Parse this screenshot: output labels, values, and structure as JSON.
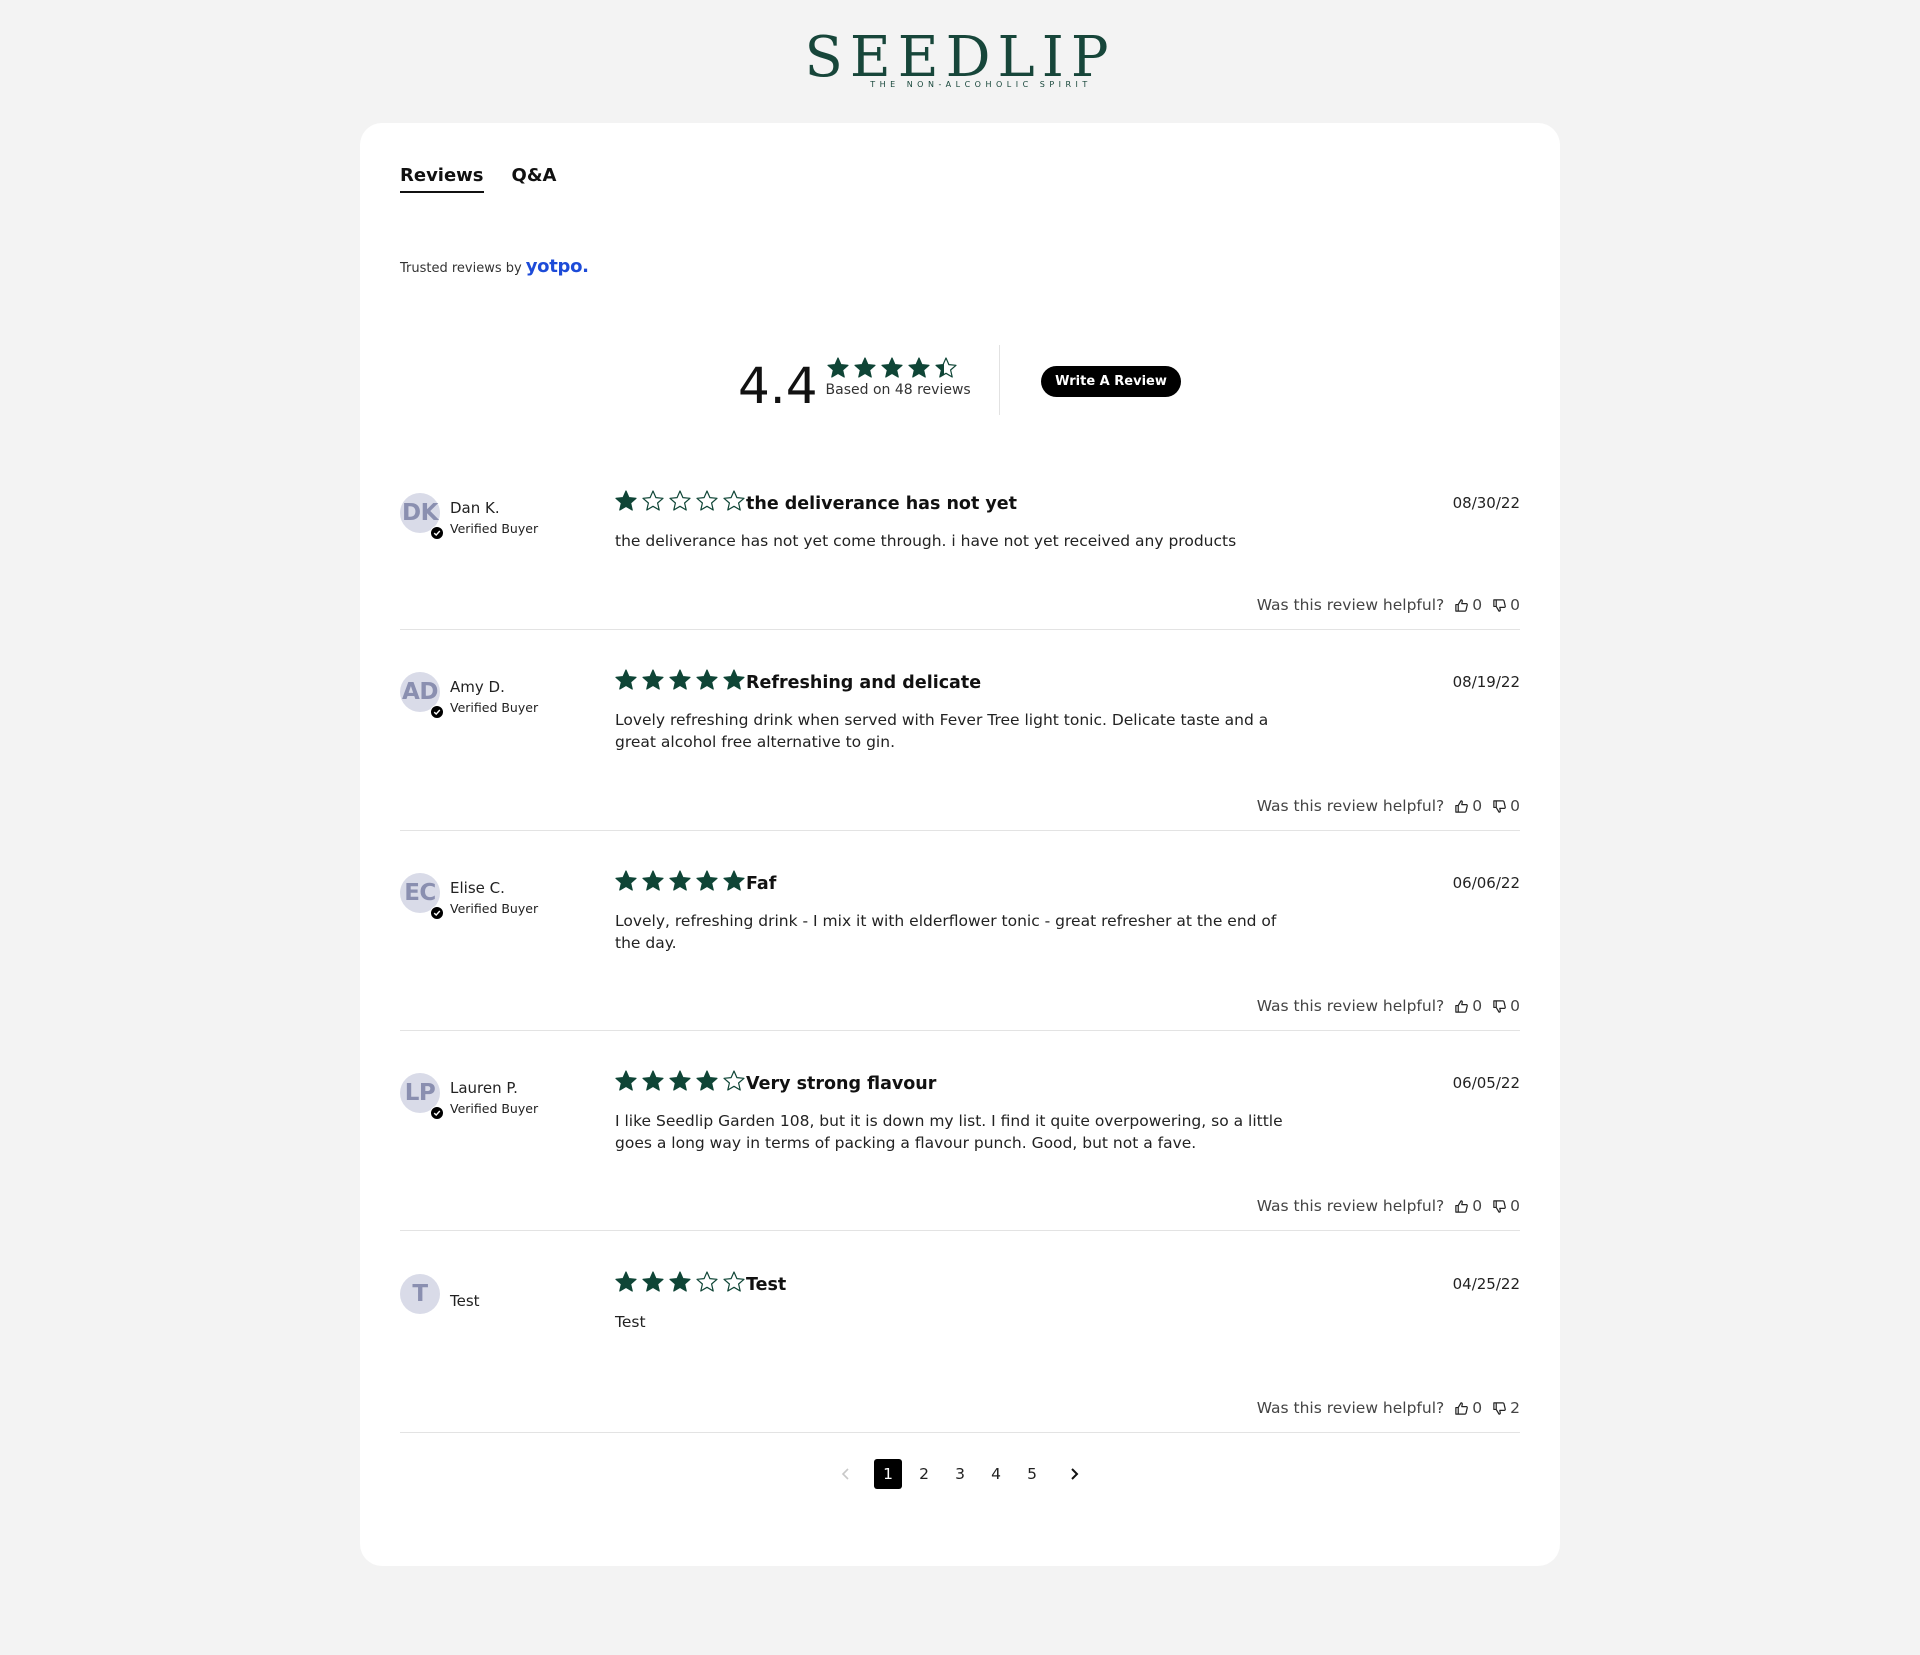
{
  "brand": {
    "name": "SEEDLIP",
    "tagline": "THE NON-ALCOHOLIC SPIRIT"
  },
  "tabs": [
    {
      "label": "Reviews",
      "active": true
    },
    {
      "label": "Q&A",
      "active": false
    }
  ],
  "trusted": {
    "prefix": "Trusted reviews by",
    "provider": "yotpo."
  },
  "summary": {
    "average": "4.4",
    "average_rating": 4.4,
    "based_on": "Based on 48 reviews",
    "write_review": "Write A Review"
  },
  "colors": {
    "star": "#0f4536",
    "brand": "#17463a",
    "accent_button": "#000000",
    "yotpo": "#1d4bd8"
  },
  "reviews": [
    {
      "initials": "DK",
      "author": "Dan K.",
      "verified": "Verified Buyer",
      "rating": 1,
      "title": "the deliverance has not yet",
      "date": "08/30/22",
      "body": "the deliverance has not yet come through. i have not yet received any products",
      "helpful_label": "Was this review helpful?",
      "up": "0",
      "down": "0"
    },
    {
      "initials": "AD",
      "author": "Amy D.",
      "verified": "Verified Buyer",
      "rating": 5,
      "title": "Refreshing and delicate",
      "date": "08/19/22",
      "body": "Lovely refreshing drink when served with Fever Tree light tonic. Delicate taste and a great alcohol free alternative to gin.",
      "helpful_label": "Was this review helpful?",
      "up": "0",
      "down": "0"
    },
    {
      "initials": "EC",
      "author": "Elise C.",
      "verified": "Verified Buyer",
      "rating": 5,
      "title": "Faf",
      "date": "06/06/22",
      "body": "Lovely, refreshing drink - I mix it with elderflower tonic - great refresher at the end of the day.",
      "helpful_label": "Was this review helpful?",
      "up": "0",
      "down": "0"
    },
    {
      "initials": "LP",
      "author": "Lauren P.",
      "verified": "Verified Buyer",
      "rating": 4,
      "title": "Very strong flavour",
      "date": "06/05/22",
      "body": "I like Seedlip Garden 108, but it is down my list. I find it quite overpowering, so a little goes a long way in terms of packing a flavour punch. Good, but not a fave.",
      "helpful_label": "Was this review helpful?",
      "up": "0",
      "down": "0"
    },
    {
      "initials": "T",
      "author": "Test",
      "verified": "",
      "rating": 3,
      "title": "Test",
      "date": "04/25/22",
      "body": "Test",
      "helpful_label": "Was this review helpful?",
      "up": "0",
      "down": "2"
    }
  ],
  "pagination": {
    "pages": [
      "1",
      "2",
      "3",
      "4",
      "5"
    ],
    "current": "1"
  }
}
